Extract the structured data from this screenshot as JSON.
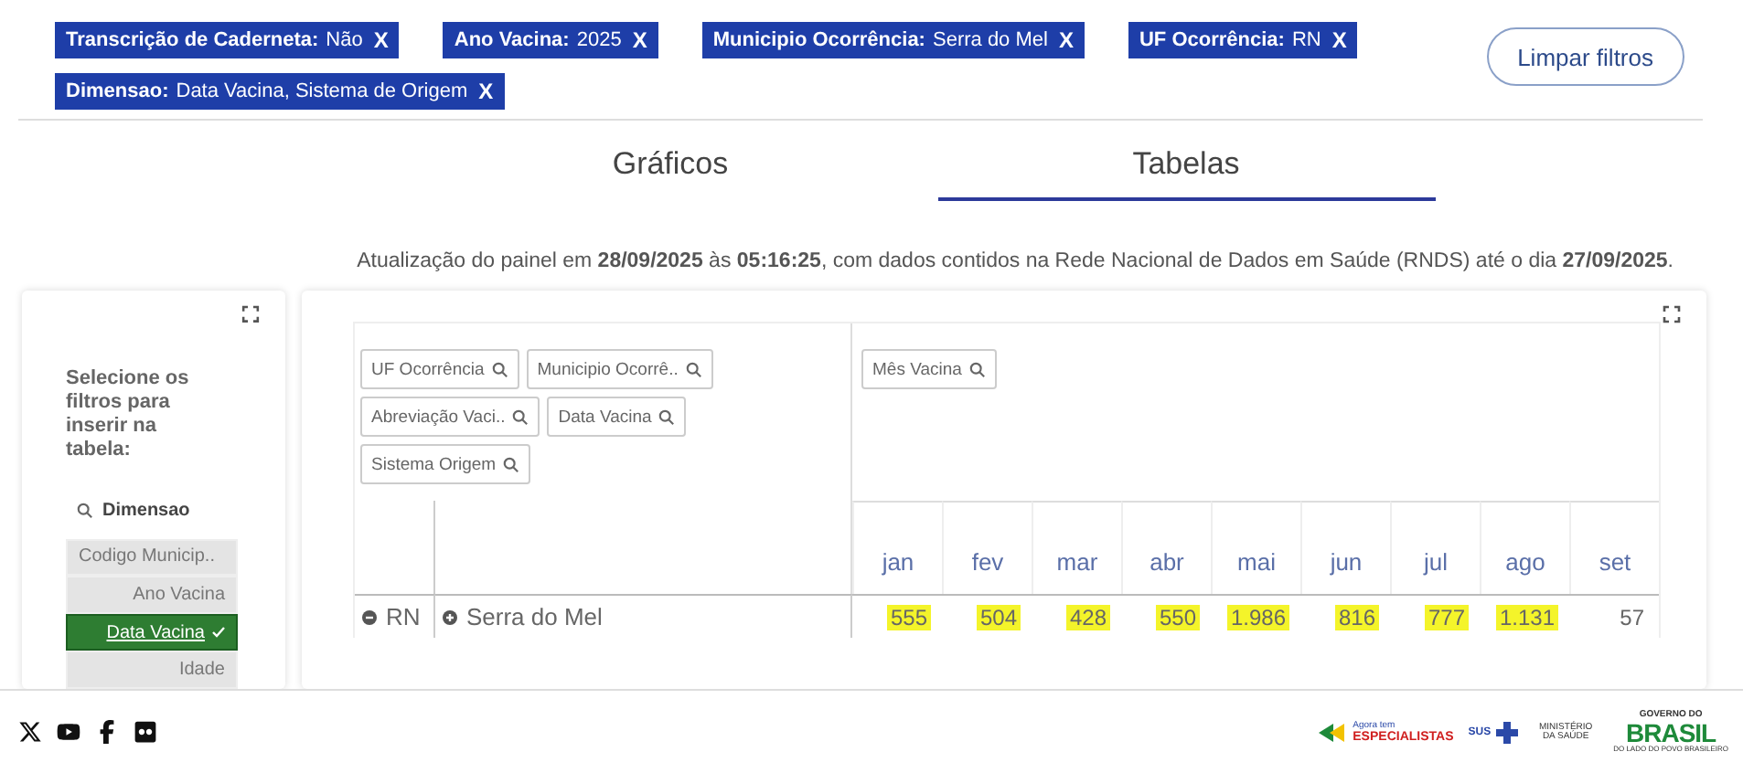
{
  "filters": [
    {
      "label": "Transcrição de Caderneta:",
      "value": "Não",
      "remove": "X"
    },
    {
      "label": "Ano Vacina:",
      "value": "2025",
      "remove": "X"
    },
    {
      "label": "Municipio Ocorrência:",
      "value": "Serra do Mel",
      "remove": "X"
    },
    {
      "label": "UF Ocorrência:",
      "value": "RN",
      "remove": "X"
    },
    {
      "label": "Dimensao:",
      "value": "Data Vacina, Sistema de Origem",
      "remove": "X"
    }
  ],
  "clear_button": "Limpar filtros",
  "tabs": [
    {
      "label": "Gráficos",
      "selected": false
    },
    {
      "label": "Tabelas",
      "selected": true
    }
  ],
  "update_note": "Atualização do painel em **28/09/2025** às **05:16:25**, com dados contidos na Rede Nacional de Dados em Saúde (RNDS) até o dia **27/09/2025**.",
  "side_panel": {
    "instructions": "Selecione os filtros para inserir na tabela:",
    "search": "Dimensao",
    "items": [
      {
        "label": "Codigo Municip..",
        "selected": false
      },
      {
        "label": "Ano Vacina",
        "selected": false
      },
      {
        "label": "Data Vacina",
        "selected": true
      },
      {
        "label": "Idade",
        "selected": false
      }
    ]
  },
  "pivot": {
    "row_fields": [
      "UF Ocorrência",
      "Municipio Ocorrê..",
      "Abreviação Vaci..",
      "Data Vacina",
      "Sistema Origem"
    ],
    "column_fields": [
      "Mês Vacina"
    ],
    "columns": [
      "jan",
      "fev",
      "mar",
      "abr",
      "mai",
      "jun",
      "jul",
      "ago",
      "set"
    ],
    "rows": [
      {
        "uf": "RN",
        "municipio": "Serra do Mel",
        "cells": [
          {
            "value": "555",
            "highlighted": true
          },
          {
            "value": "504",
            "highlighted": true
          },
          {
            "value": "428",
            "highlighted": true
          },
          {
            "value": "550",
            "highlighted": true
          },
          {
            "value": "1.986",
            "highlighted": true
          },
          {
            "value": "816",
            "highlighted": true
          },
          {
            "value": "777",
            "highlighted": true
          },
          {
            "value": "1.131",
            "highlighted": true
          },
          {
            "value": "57",
            "highlighted": false
          }
        ]
      }
    ]
  },
  "footer": {
    "logos": {
      "especialistas_top": "Agora tem",
      "especialistas": "ESPECIALISTAS",
      "sus": "SUS",
      "ministerio": "MINISTÉRIO DA SAÚDE",
      "governo": "GOVERNO DO",
      "brasil": "BRASIL",
      "slogan": "DO LADO DO POVO BRASILEIRO"
    }
  }
}
